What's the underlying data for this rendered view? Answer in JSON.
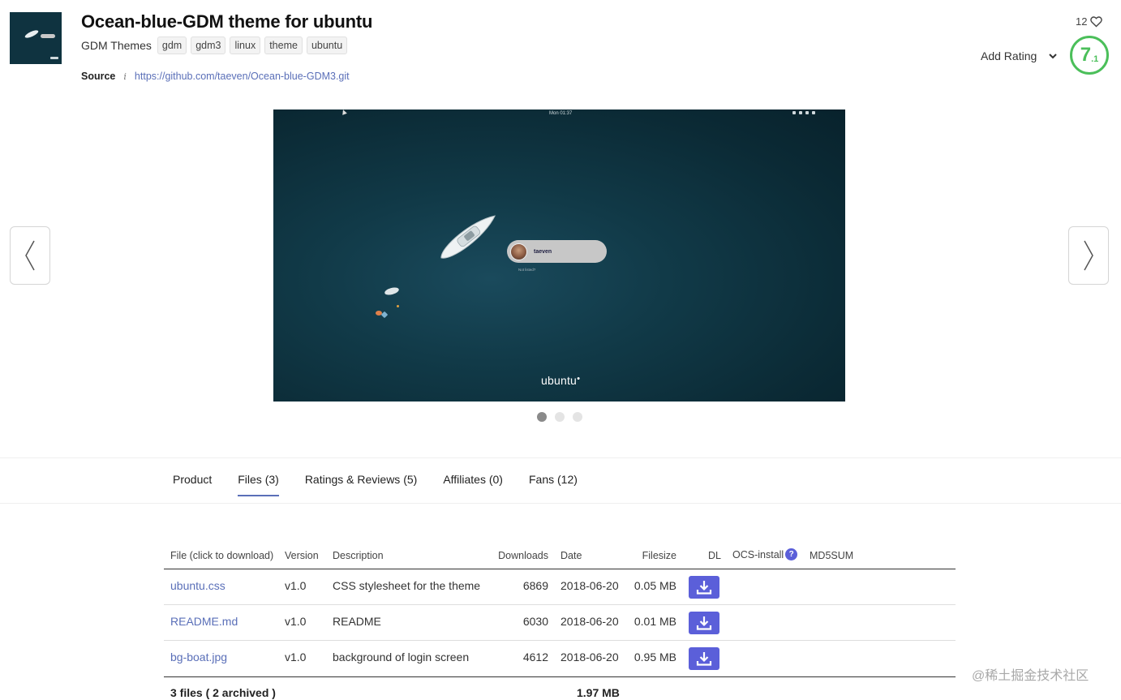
{
  "product": {
    "title": "Ocean-blue-GDM theme for ubuntu",
    "category": "GDM Themes",
    "tags": [
      "gdm",
      "gdm3",
      "linux",
      "theme",
      "ubuntu"
    ],
    "source_label": "Source",
    "source_info_icon": "i",
    "source_url": "https://github.com/taeven/Ocean-blue-GDM3.git"
  },
  "rating": {
    "likes": "12",
    "add_rating_label": "Add Rating",
    "score_major": "7",
    "score_minor": ".1",
    "score_color": "#4bbf5a"
  },
  "screenshot": {
    "topbar_time": "Mon 01:37",
    "login_user": "taeven",
    "not_listed": "Not listed?",
    "os_logo": "ubuntu",
    "slide_count": 3,
    "active_slide": 0
  },
  "tabs": [
    {
      "label": "Product",
      "active": false
    },
    {
      "label": "Files (3)",
      "active": true
    },
    {
      "label": "Ratings & Reviews (5)",
      "active": false
    },
    {
      "label": "Affiliates (0)",
      "active": false
    },
    {
      "label": "Fans (12)",
      "active": false
    }
  ],
  "files": {
    "headers": {
      "file": "File (click to download)",
      "version": "Version",
      "description": "Description",
      "downloads": "Downloads",
      "date": "Date",
      "filesize": "Filesize",
      "dl": "DL",
      "ocs": "OCS-install",
      "md5": "MD5SUM"
    },
    "rows": [
      {
        "file": "ubuntu.css",
        "version": "v1.0",
        "description": "CSS stylesheet for the theme",
        "downloads": "6869",
        "date": "2018-06-20",
        "filesize": "0.05 MB"
      },
      {
        "file": "README.md",
        "version": "v1.0",
        "description": "README",
        "downloads": "6030",
        "date": "2018-06-20",
        "filesize": "0.01 MB"
      },
      {
        "file": "bg-boat.jpg",
        "version": "v1.0",
        "description": "background of login screen",
        "downloads": "4612",
        "date": "2018-06-20",
        "filesize": "0.95 MB"
      }
    ],
    "footer": {
      "count": "3 files ( 2 archived )",
      "total": "1.97 MB"
    }
  },
  "watermark": "@稀土掘金技术社区",
  "colors": {
    "accent": "#5b5fd9",
    "link": "#5a6fb8"
  }
}
